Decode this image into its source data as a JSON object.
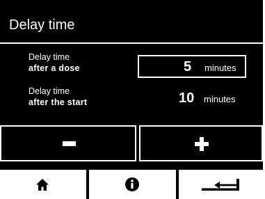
{
  "header": {
    "title": "Delay time"
  },
  "settings": [
    {
      "label_line1": "Delay time",
      "label_line2": "after a dose",
      "value": "5",
      "unit": "minutes"
    },
    {
      "label_line1": "Delay time",
      "label_line2": "after the start",
      "value": "10",
      "unit": "minutes"
    }
  ],
  "controls": {
    "decrease_icon": "minus-icon",
    "increase_icon": "plus-icon"
  },
  "nav": {
    "home_icon": "home-icon",
    "info_icon": "info-icon",
    "back_icon": "return-arrow-icon"
  },
  "colors": {
    "background": "#000000",
    "foreground": "#ffffff"
  }
}
